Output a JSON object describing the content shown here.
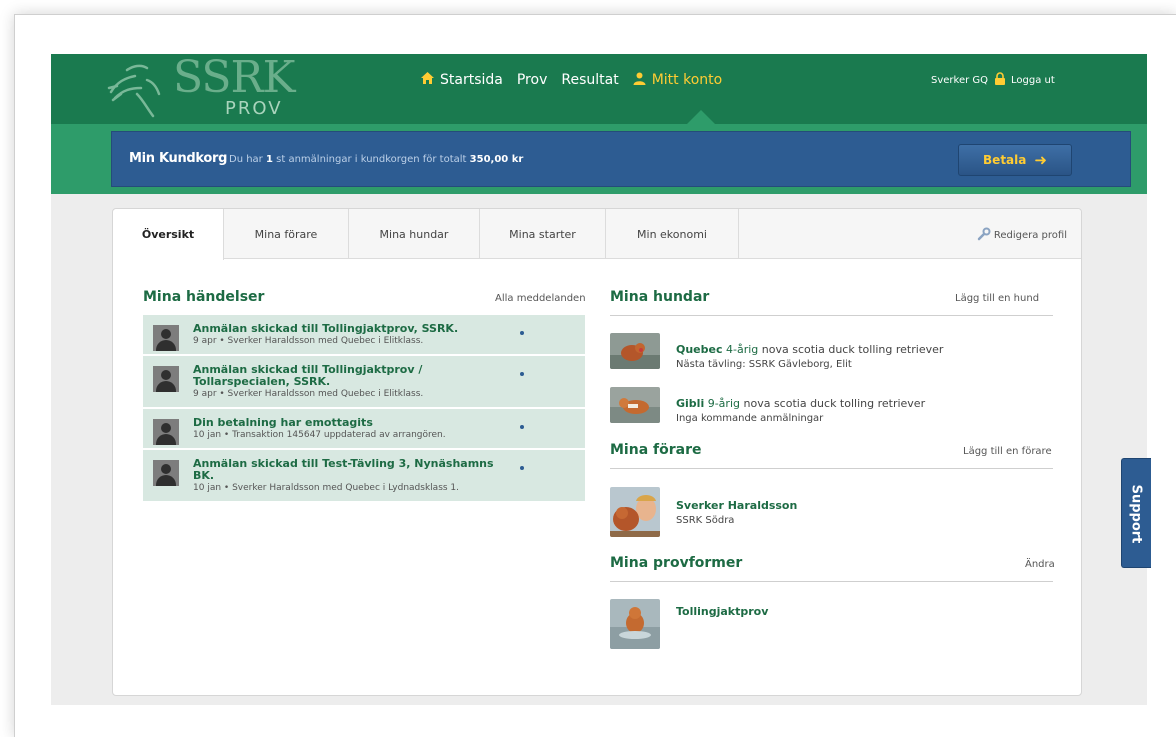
{
  "header": {
    "logo_main": "SSRK",
    "logo_sub": "PROV",
    "nav": [
      {
        "label": "Startsida"
      },
      {
        "label": "Prov"
      },
      {
        "label": "Resultat"
      },
      {
        "label": "Mitt konto"
      }
    ],
    "user": "Sverker GQ",
    "logout": "Logga ut"
  },
  "cart": {
    "title": "Min Kundkorg",
    "msg_pre": "Du har",
    "count": "1",
    "msg_mid": "st anmälningar i kundkorgen för totalt",
    "amount": "350,00 kr",
    "pay_label": "Betala"
  },
  "tabs": {
    "items": [
      {
        "label": "Översikt"
      },
      {
        "label": "Mina förare"
      },
      {
        "label": "Mina hundar"
      },
      {
        "label": "Mina starter"
      },
      {
        "label": "Min ekonomi"
      }
    ],
    "edit_profile": "Redigera profil"
  },
  "events": {
    "title": "Mina händelser",
    "all_link": "Alla meddelanden",
    "items": [
      {
        "title": "Anmälan skickad till Tollingjaktprov, SSRK.",
        "meta": "9 apr  •  Sverker Haraldsson med Quebec i Elitklass."
      },
      {
        "title": "Anmälan skickad till Tollingjaktprov / Tollarspecialen, SSRK.",
        "meta": "9 apr  •  Sverker Haraldsson med Quebec i Elitklass."
      },
      {
        "title": "Din betalning har emottagits",
        "meta": "10 jan  •  Transaktion 145647 uppdaterad av arrangören."
      },
      {
        "title": "Anmälan skickad till Test-Tävling 3, Nynäshamns BK.",
        "meta": "10 jan  •  Sverker Haraldsson med Quebec i Lydnadsklass 1."
      }
    ]
  },
  "dogs": {
    "title": "Mina hundar",
    "add_link": "Lägg till en hund",
    "items": [
      {
        "name": "Quebec",
        "age": "4-årig",
        "breed": "nova scotia duck tolling retriever",
        "next": "Nästa tävling: SSRK Gävleborg, Elit"
      },
      {
        "name": "Gibli",
        "age": "9-årig",
        "breed": "nova scotia duck tolling retriever",
        "next": "Inga kommande anmälningar"
      }
    ]
  },
  "handlers": {
    "title": "Mina förare",
    "add_link": "Lägg till en förare",
    "items": [
      {
        "name": "Sverker Haraldsson",
        "club": "SSRK Södra"
      }
    ]
  },
  "trialtypes": {
    "title": "Mina provformer",
    "edit_link": "Ändra",
    "items": [
      {
        "name": "Tollingjaktprov"
      }
    ]
  },
  "support": {
    "label": "Support"
  },
  "colors": {
    "brand_green": "#1a7a4f",
    "band_green": "#2e9c6a",
    "cart_blue": "#2d5c92",
    "accent_yellow": "#ffcc33"
  }
}
